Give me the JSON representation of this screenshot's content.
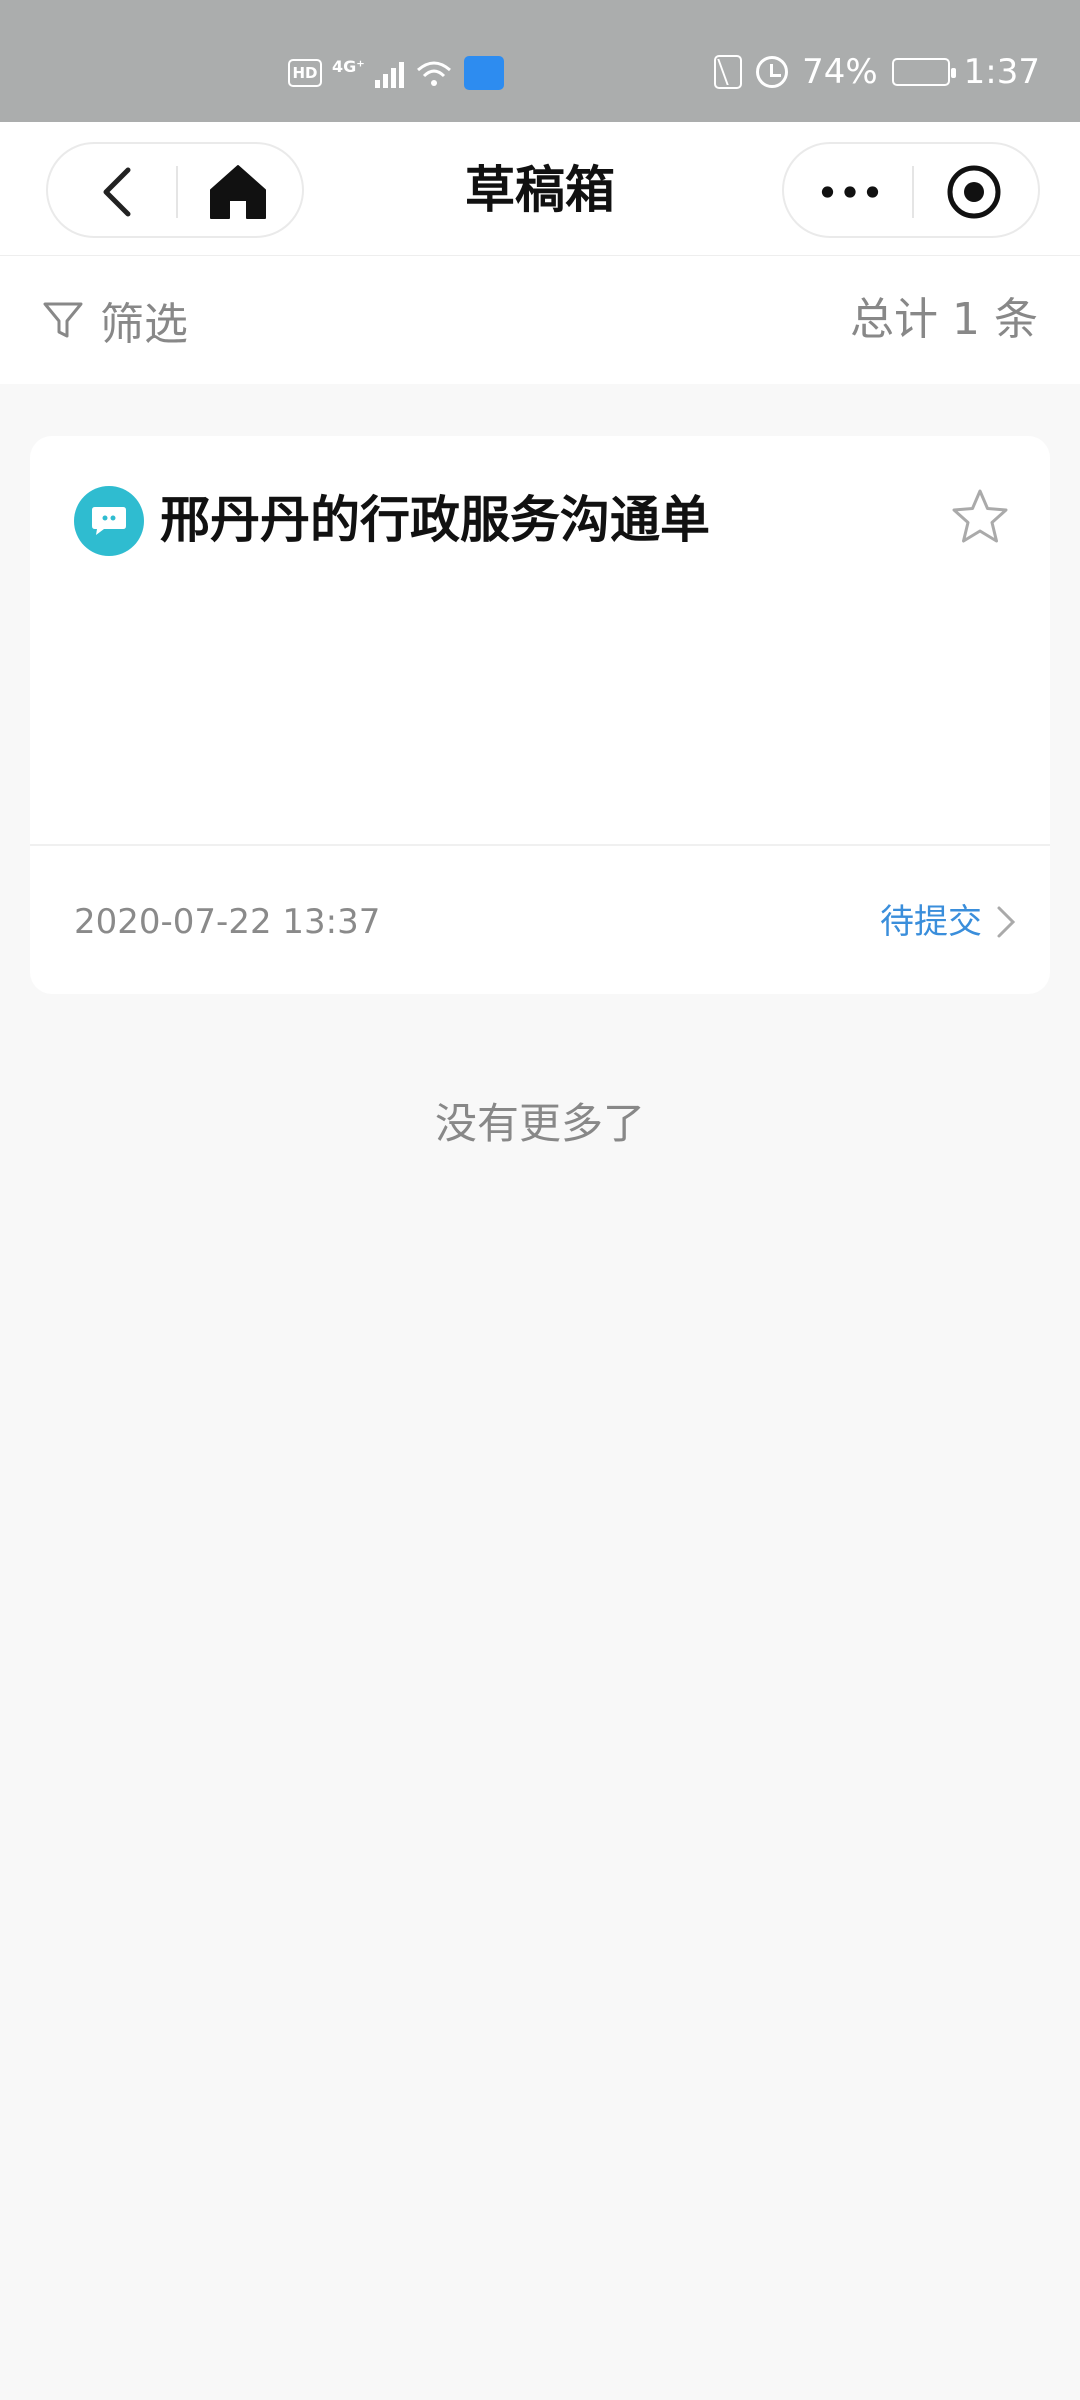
{
  "status_bar": {
    "hd": "HD",
    "network": "4G⁺",
    "battery_percent": "74%",
    "battery_level": 0.74,
    "time": "1:37"
  },
  "header": {
    "title": "草稿箱",
    "left_icons": [
      "back-icon",
      "home-icon"
    ],
    "right_icons": [
      "more-icon",
      "target-icon"
    ]
  },
  "filter_bar": {
    "filter_label": "筛选",
    "total_label": "总计 1 条"
  },
  "cards": [
    {
      "icon": "chat-bubble-icon",
      "title": "邢丹丹的行政服务沟通单",
      "date": "2020-07-22 13:37",
      "status": "待提交",
      "starred": false
    }
  ],
  "footer": {
    "no_more_text": "没有更多了"
  },
  "colors": {
    "status_bar_bg": "#abadad",
    "accent_teal": "#2fbcd0",
    "link_blue": "#3a8edb",
    "page_bg": "#f8f8f8"
  }
}
